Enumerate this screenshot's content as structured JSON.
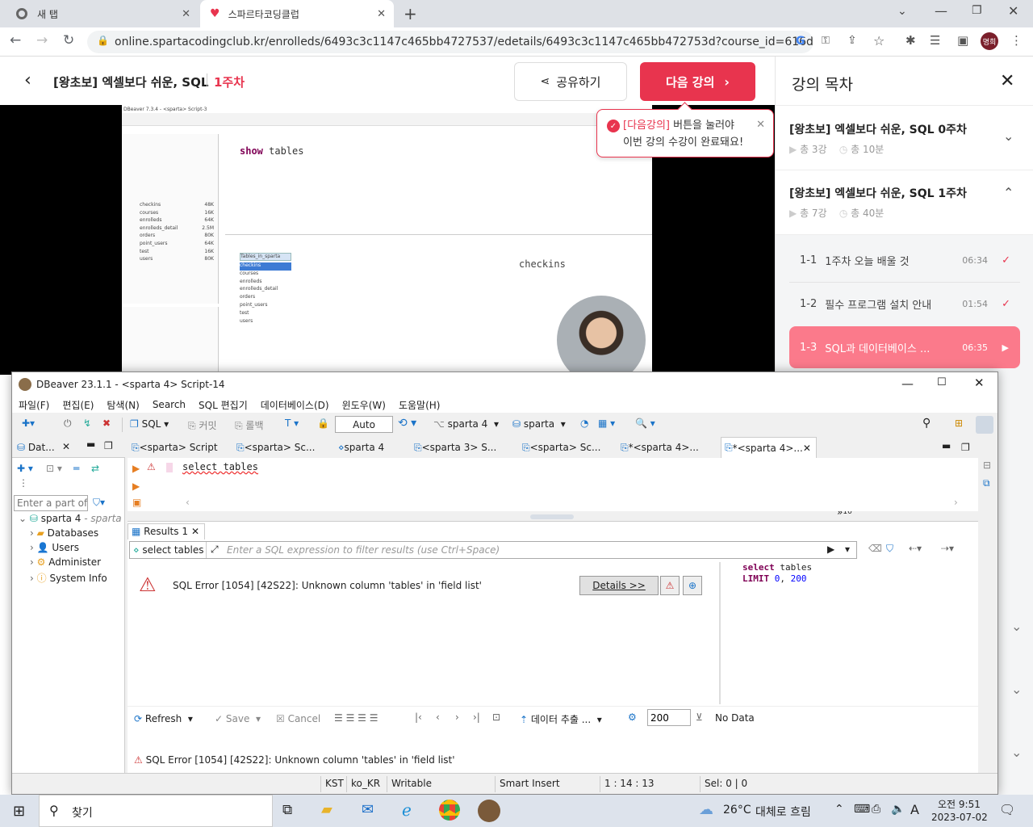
{
  "browser": {
    "tabs": [
      {
        "title": "새 탭"
      },
      {
        "title": "스파르타코딩클럽"
      }
    ],
    "url": "online.spartacodingclub.kr/enrolleds/6493c3c1147c465bb4727537/edetails/6493c3c1147c465bb472753d?course_id=616d434946...",
    "profile_label": "명희"
  },
  "course_header": {
    "title": "[왕초보] 엑셀보다 쉬운, SQL",
    "week": "1주차",
    "share_label": "공유하기",
    "next_label": "다음 강의",
    "tooltip_highlight": "[다음강의]",
    "tooltip_line1": "버튼을 눌러야",
    "tooltip_line2": "이번 강의 수강이 완료돼요!"
  },
  "video": {
    "window_title": "DBeaver 7.3.4 - <sparta> Script-3",
    "query": "show tables",
    "result_header": "Tables_in_sparta",
    "result_rows": [
      "checkins",
      "courses",
      "enrolleds",
      "enrolleds_detail",
      "orders",
      "point_users",
      "test",
      "users"
    ],
    "value_panel": "checkins",
    "tables": [
      {
        "name": "checkins",
        "size": "48K"
      },
      {
        "name": "courses",
        "size": "16K"
      },
      {
        "name": "enrolleds",
        "size": "64K"
      },
      {
        "name": "enrolleds_detail",
        "size": "2.5M"
      },
      {
        "name": "orders",
        "size": "80K"
      },
      {
        "name": "point_users",
        "size": "64K"
      },
      {
        "name": "test",
        "size": "16K"
      },
      {
        "name": "users",
        "size": "80K"
      }
    ]
  },
  "sidebar": {
    "title": "강의 목차",
    "weeks": [
      {
        "title": "[왕초보] 엑셀보다 쉬운, SQL 0주차",
        "count": "총 3강",
        "duration": "총 10분"
      },
      {
        "title": "[왕초보] 엑셀보다 쉬운, SQL 1주차",
        "count": "총 7강",
        "duration": "총 40분"
      }
    ],
    "lessons": [
      {
        "num": "1-1",
        "title": "1주차 오늘 배울 것",
        "time": "06:34"
      },
      {
        "num": "1-2",
        "title": "필수 프로그램 설치 안내",
        "time": "01:54"
      },
      {
        "num": "1-3",
        "title": "SQL과 데이터베이스 ...",
        "time": "06:35"
      }
    ]
  },
  "dbeaver": {
    "title": "DBeaver 23.1.1 - <sparta 4> Script-14",
    "menu": [
      "파일(F)",
      "편집(E)",
      "탐색(N)",
      "Search",
      "SQL 편집기",
      "데이터베이스(D)",
      "윈도우(W)",
      "도움말(H)"
    ],
    "toolbar": {
      "sql": "SQL",
      "commit": "커밋",
      "rollback": "롤백",
      "auto": "Auto",
      "connection": "sparta 4",
      "database": "sparta"
    },
    "navigator": {
      "tab_label": "Dat...",
      "filter_placeholder": "Enter a part of c",
      "connection": "sparta 4",
      "connection_sub": "- sparta",
      "items": [
        "Databases",
        "Users",
        "Administer",
        "System Info"
      ]
    },
    "editor_tabs": [
      "<sparta> Script",
      "<sparta> Sc...",
      "sparta 4",
      "<sparta 3> S...",
      "<sparta> Sc...",
      "*<sparta 4>...",
      "*<sparta 4>..."
    ],
    "more_tabs": "10",
    "query": "select tables",
    "results": {
      "tab_label": "Results 1",
      "query_label": "select tables",
      "filter_placeholder": "Enter a SQL expression to filter results (use Ctrl+Space)",
      "error": "SQL Error [1054] [42S22]: Unknown column 'tables' in 'field list'",
      "details_label": "Details >>",
      "side_query_line1_kw": "select",
      "side_query_line1_rest": " tables",
      "side_query_line2_kw": "LIMIT",
      "side_query_line2_a": "0",
      "side_query_line2_b": "200"
    },
    "bottom": {
      "refresh": "Refresh",
      "save": "Save",
      "cancel": "Cancel",
      "export": "데이터 추출 ...",
      "limit": "200",
      "no_data": "No Data"
    },
    "status_error": "SQL Error [1054] [42S22]: Unknown column 'tables' in 'field list'",
    "statusbar": [
      "KST",
      "ko_KR",
      "Writable",
      "Smart Insert",
      "1 : 14 : 13",
      "Sel: 0 | 0"
    ]
  },
  "taskbar": {
    "search": "찾기",
    "weather_temp": "26°C",
    "weather_text": "대체로 흐림",
    "time": "오전 9:51",
    "date": "2023-07-02",
    "ime": "A"
  },
  "colors": {
    "accent": "#e8344e",
    "lesson_active": "#fb7a8b",
    "check": "#e8344e"
  }
}
